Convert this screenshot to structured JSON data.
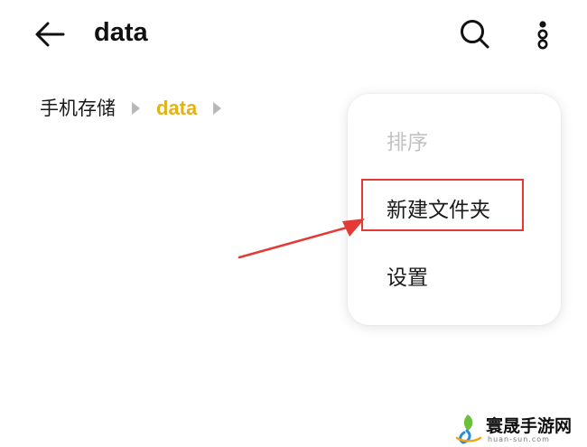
{
  "header": {
    "title": "data",
    "back_icon": "arrow-left-icon",
    "search_icon": "search-icon",
    "more_icon": "more-vertical-icon"
  },
  "breadcrumb": {
    "items": [
      "手机存储",
      "data"
    ],
    "current_color": "#e3b214"
  },
  "menu": {
    "items": [
      {
        "label": "排序",
        "enabled": false
      },
      {
        "label": "新建文件夹",
        "enabled": true,
        "highlighted": true
      },
      {
        "label": "设置",
        "enabled": true
      }
    ]
  },
  "annotation": {
    "color": "#e53935"
  },
  "watermark": {
    "name": "寰晟手游网",
    "url": "huan-sun.com"
  }
}
